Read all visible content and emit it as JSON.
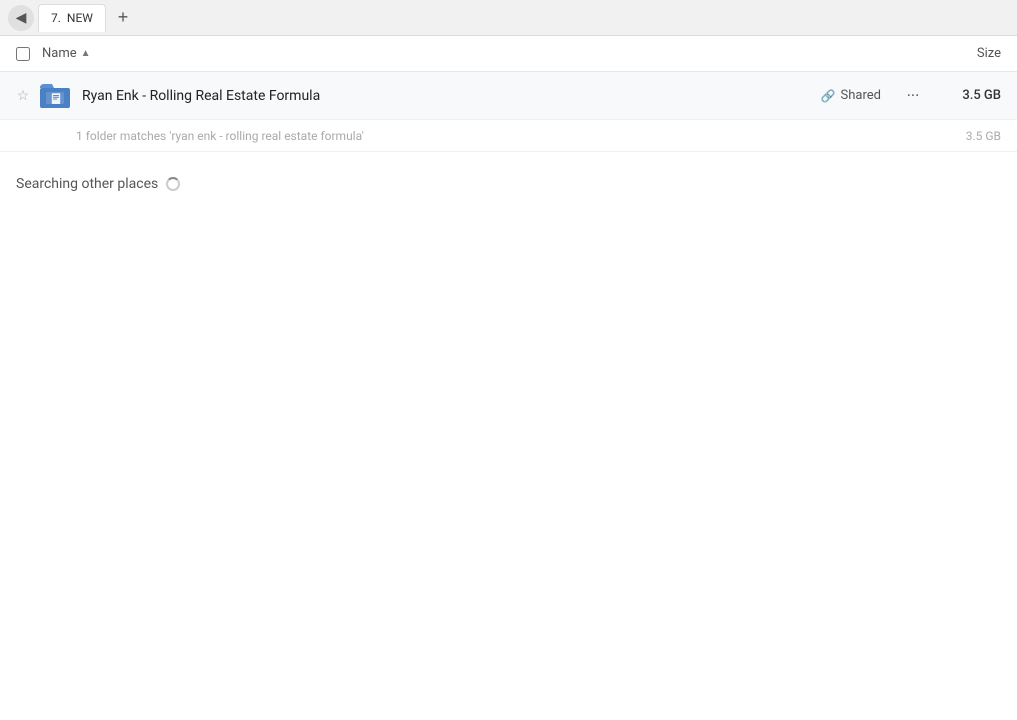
{
  "tabBar": {
    "backButton": "◀",
    "tab": {
      "number": "7.",
      "label": "NEW"
    },
    "newTabButton": "+"
  },
  "columnHeader": {
    "nameLabel": "Name",
    "sortArrow": "▲",
    "sizeLabel": "Size"
  },
  "fileRow": {
    "name": "Ryan Enk - Rolling Real Estate Formula",
    "sharedLabel": "Shared",
    "moreLabel": "···",
    "size": "3.5 GB"
  },
  "infoRow": {
    "matchText": "1 folder matches 'ryan enk - rolling real estate formula'",
    "size": "3.5 GB"
  },
  "searchingSection": {
    "label": "Searching other places"
  }
}
